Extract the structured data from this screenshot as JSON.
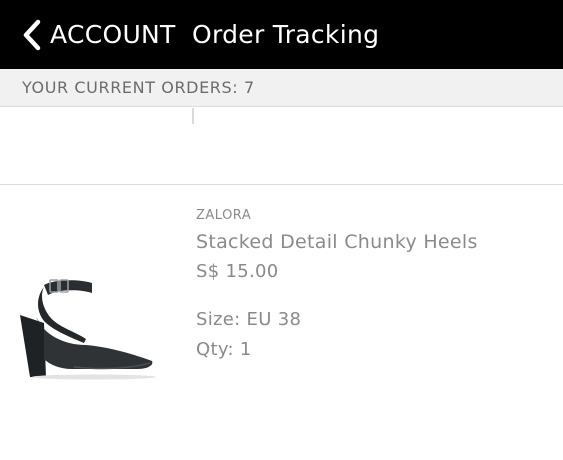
{
  "header": {
    "back_label": "ACCOUNT",
    "back_icon": "chevron-left-icon",
    "title": "Order Tracking",
    "background": "#000000",
    "text_color": "#ffffff"
  },
  "summary": {
    "current_orders_text": "YOUR CURRENT ORDERS: 7"
  },
  "order_item": {
    "brand": "ZALORA",
    "name": "Stacked Detail Chunky Heels",
    "price": "S$ 15.00",
    "size": "Size: EU 38",
    "qty": "Qty: 1",
    "image": "black-heel-shoe-image"
  }
}
